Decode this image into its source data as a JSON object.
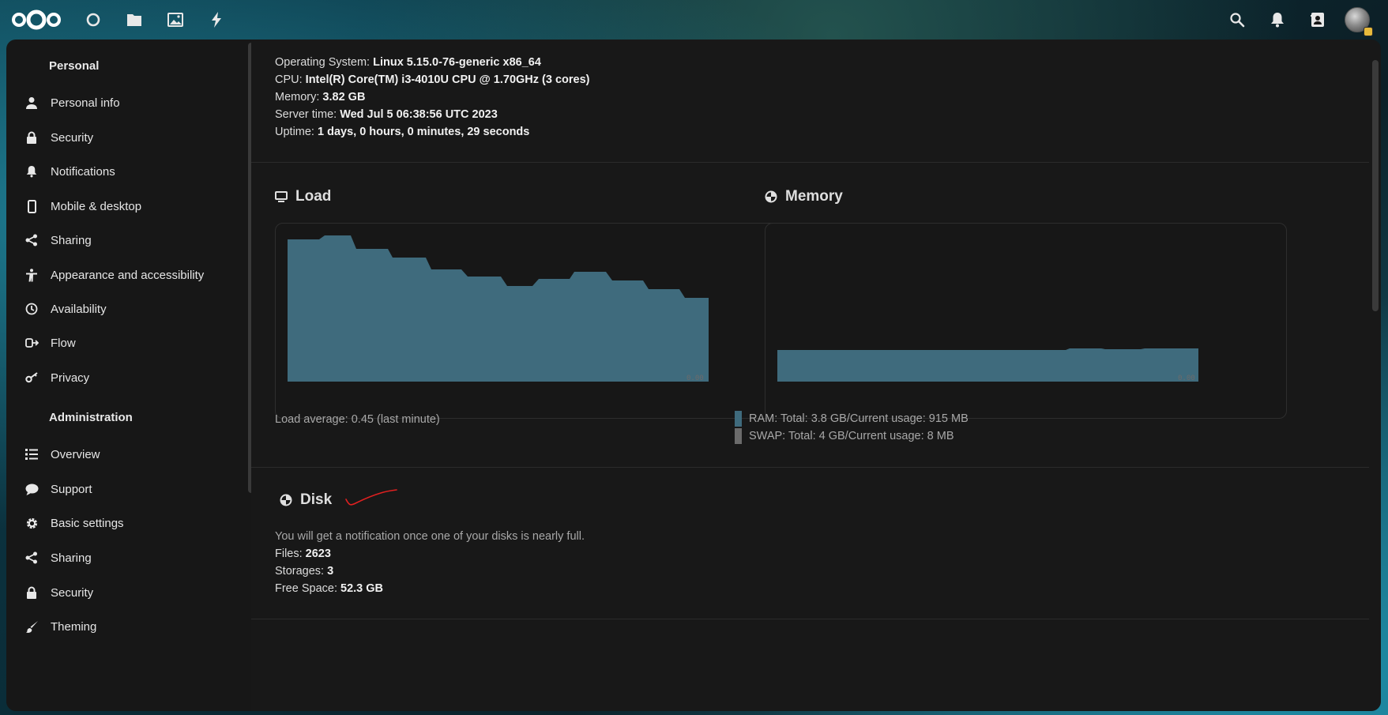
{
  "header": {
    "apps": [
      "dashboard-icon",
      "files-icon",
      "photos-icon",
      "activity-icon"
    ],
    "right": [
      "search-icon",
      "notifications-icon",
      "contacts-icon",
      "avatar"
    ]
  },
  "sidebar": {
    "personal_heading": "Personal",
    "personal_items": [
      {
        "label": "Personal info",
        "icon": "user-icon"
      },
      {
        "label": "Security",
        "icon": "lock-icon"
      },
      {
        "label": "Notifications",
        "icon": "bell-icon"
      },
      {
        "label": "Mobile & desktop",
        "icon": "phone-icon"
      },
      {
        "label": "Sharing",
        "icon": "share-icon"
      },
      {
        "label": "Appearance and accessibility",
        "icon": "accessibility-icon"
      },
      {
        "label": "Availability",
        "icon": "clock-icon"
      },
      {
        "label": "Flow",
        "icon": "flow-icon"
      },
      {
        "label": "Privacy",
        "icon": "key-icon"
      }
    ],
    "admin_heading": "Administration",
    "admin_items": [
      {
        "label": "Overview",
        "icon": "list-icon"
      },
      {
        "label": "Support",
        "icon": "chat-icon"
      },
      {
        "label": "Basic settings",
        "icon": "gear-icon"
      },
      {
        "label": "Sharing",
        "icon": "share-icon"
      },
      {
        "label": "Security",
        "icon": "lock-icon"
      },
      {
        "label": "Theming",
        "icon": "brush-icon"
      }
    ]
  },
  "system": {
    "os_label": "Operating System: ",
    "os_value": "Linux 5.15.0-76-generic x86_64",
    "cpu_label": "CPU: ",
    "cpu_value": "Intel(R) Core(TM) i3-4010U CPU @ 1.70GHz (3 cores)",
    "mem_label": "Memory: ",
    "mem_value": "3.82 GB",
    "time_label": "Server time: ",
    "time_value": "Wed Jul 5 06:38:56 UTC 2023",
    "uptime_label": "Uptime: ",
    "uptime_value": "1 days, 0 hours, 0 minutes, 29 seconds"
  },
  "load": {
    "title": "Load",
    "caption": "Load average: 0.45 (last minute)",
    "min_label": "0.00"
  },
  "memory": {
    "title": "Memory",
    "min_label": "0.00",
    "ram_legend": "RAM: Total: 3.8 GB/Current usage: 915 MB",
    "swap_legend": "SWAP: Total: 4 GB/Current usage: 8 MB",
    "ram_color": "#3f6b7d",
    "swap_color": "#6b6b6b"
  },
  "disk": {
    "title": "Disk",
    "note": "You will get a notification once one of your disks is nearly full.",
    "files_label": "Files: ",
    "files_value": "2623",
    "storages_label": "Storages: ",
    "storages_value": "3",
    "free_label": "Free Space: ",
    "free_value": "52.3 GB"
  },
  "colors": {
    "accent": "#3f6b7d",
    "annotation": "#e02020"
  }
}
